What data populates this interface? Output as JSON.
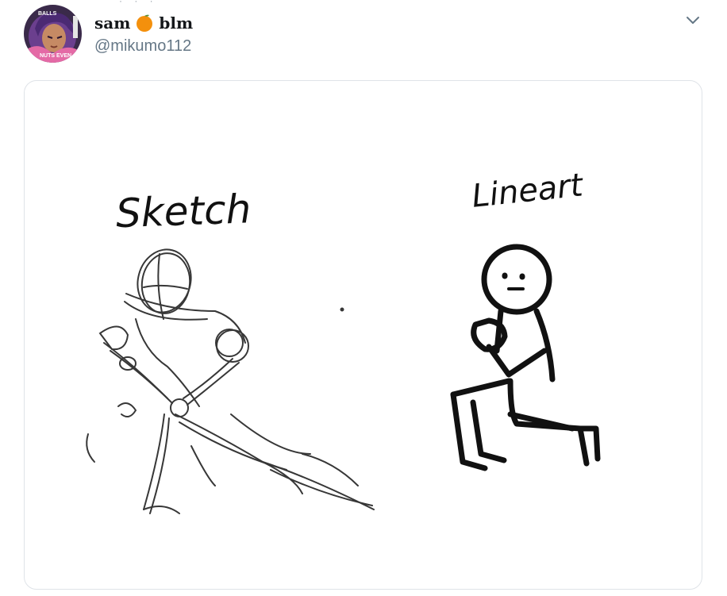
{
  "tweet": {
    "display_name_part1": "sam",
    "display_name_part2": "blm",
    "handle": "@mikumo112",
    "name_emoji": "orange-emoji"
  },
  "avatar": {
    "top_text": "BALLS",
    "bottom_text": "NUTS EVEN"
  },
  "media": {
    "label_left": "Sketch",
    "label_right": "Lineart"
  },
  "colors": {
    "name": "#14171a",
    "handle": "#657786",
    "card_border": "#dfe3e8",
    "ink": "#111111"
  }
}
